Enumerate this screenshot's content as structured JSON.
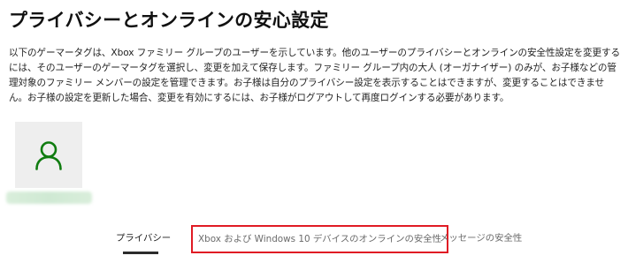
{
  "page": {
    "title": "プライバシーとオンラインの安心設定",
    "description": "以下のゲーマータグは、Xbox ファミリー グループのユーザーを示しています。他のユーザーのプライバシーとオンラインの安全性設定を変更するには、そのユーザーのゲーマータグを選択し、変更を加えて保存します。ファミリー グループ内の大人 (オーガナイザー) のみが、お子様などの管理対象のファミリー メンバーの設定を管理できます。お子様は自分のプライバシー設定を表示することはできますが、変更することはできません。お子様の設定を更新した場合、変更を有効にするには、お子様がログアウトして再度ログインする必要があります。"
  },
  "member": {
    "avatar_icon": "person-outline-icon",
    "avatar_color": "#107c10"
  },
  "tabs": [
    {
      "label": "プライバシー",
      "selected": true
    },
    {
      "label": "Xbox および Windows 10 デバイスのオンラインの安全性",
      "highlighted": true
    },
    {
      "label": "メッセージの安全性"
    }
  ],
  "colors": {
    "highlight_border": "#e01b24",
    "accent_green": "#107c10"
  }
}
